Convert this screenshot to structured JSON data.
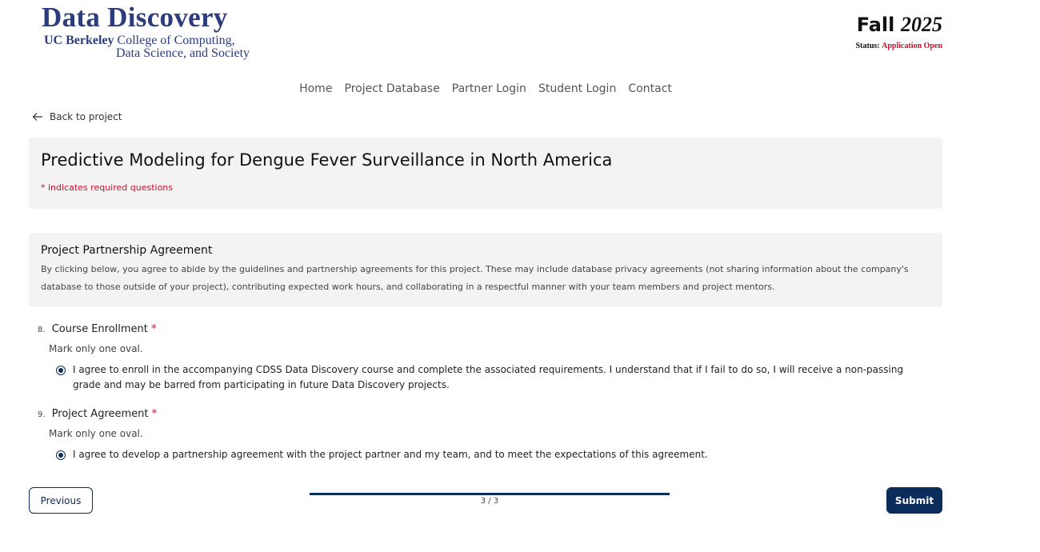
{
  "header": {
    "logo_title": "Data Discovery",
    "logo_ucb": "UC Berkeley",
    "logo_line1_rest": "College of Computing,",
    "logo_line2": "Data Science, and Society",
    "term_season": "Fall",
    "term_year": "2025",
    "status_label": "Status:",
    "status_value": "Application Open"
  },
  "nav": {
    "items": [
      "Home",
      "Project Database",
      "Partner Login",
      "Student Login",
      "Contact"
    ]
  },
  "back_link": "Back to project",
  "form": {
    "title": "Predictive Modeling for Dengue Fever Surveillance in North America",
    "required_note": "* indicates required questions",
    "section": {
      "heading": "Project Partnership Agreement",
      "description": "By clicking below, you agree to abide by the guidelines and partnership agreements for this project. These may include database privacy agreements (not sharing information about the company's database to those outside of your project), contributing expected work hours, and collaborating in a respectful manner with your team members and project mentors."
    },
    "questions": [
      {
        "number": "8.",
        "label": "Course Enrollment",
        "required_mark": "*",
        "hint": "Mark only one oval.",
        "option": "I agree to enroll in the accompanying CDSS Data Discovery course and complete the associated requirements. I understand that if I fail to do so, I will receive a non-passing grade and may be barred from participating in future Data Discovery projects."
      },
      {
        "number": "9.",
        "label": "Project Agreement",
        "required_mark": "*",
        "hint": "Mark only one oval.",
        "option": "I agree to develop a partnership agreement with the project partner and my team, and to meet the expectations of this agreement."
      }
    ]
  },
  "footer": {
    "previous_label": "Previous",
    "submit_label": "Submit",
    "page_indicator": "3 / 3",
    "progress_fraction": 1.0
  },
  "colors": {
    "brand_navy": "#0b2d5b",
    "logo_blue": "#2d3d7c",
    "required_red": "#c8102e"
  }
}
